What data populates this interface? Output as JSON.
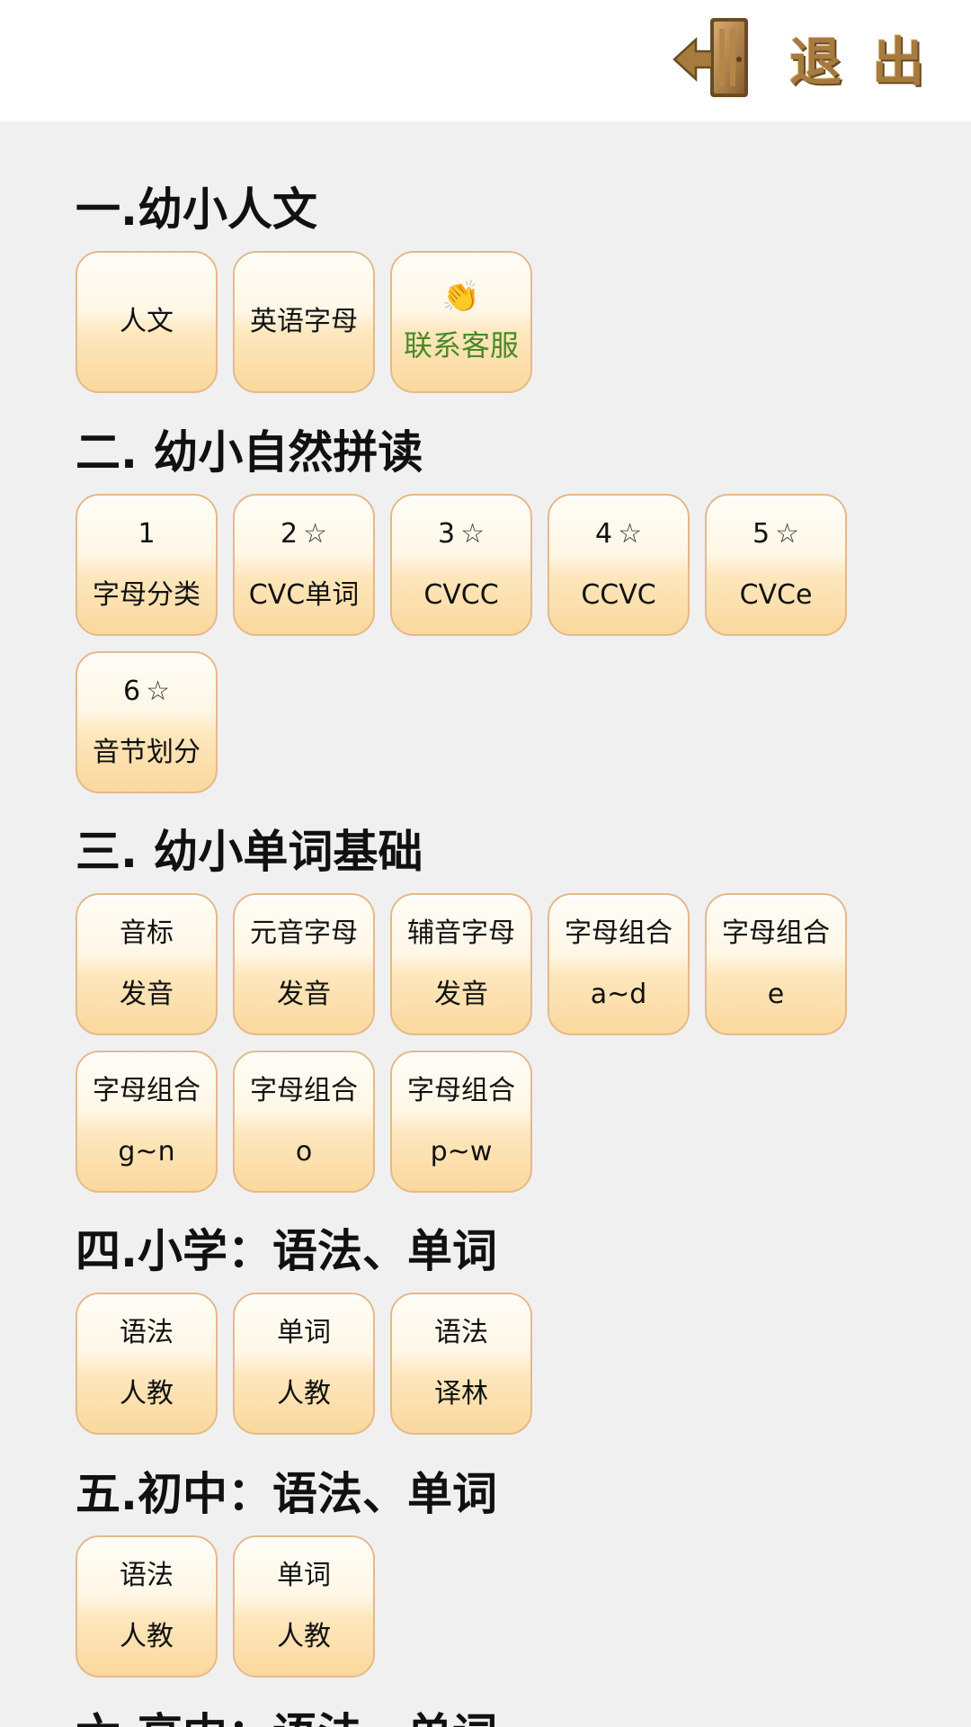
{
  "header": {
    "exit_label": "退出",
    "exit_icon": "exit-door-arrow-icon"
  },
  "sections": [
    {
      "title": "一.幼小人文",
      "tiles": [
        {
          "line1": "人文"
        },
        {
          "line1": "英语字母"
        },
        {
          "icon": "👏",
          "line1": "联系客服"
        }
      ]
    },
    {
      "title": "二. 幼小自然拼读",
      "tiles": [
        {
          "line1": "1",
          "line2": "字母分类"
        },
        {
          "line1": "2",
          "star": "☆",
          "line2": "CVC单词"
        },
        {
          "line1": "3",
          "star": "☆",
          "line2": "CVCC"
        },
        {
          "line1": "4",
          "star": "☆",
          "line2": "CCVC"
        },
        {
          "line1": "5",
          "star": "☆",
          "line2": "CVCe"
        },
        {
          "line1": "6",
          "star": "☆",
          "line2": "音节划分"
        }
      ]
    },
    {
      "title": "三. 幼小单词基础",
      "tiles": [
        {
          "line1": "音标",
          "line2": "发音"
        },
        {
          "line1": "元音字母",
          "line2": "发音"
        },
        {
          "line1": "辅音字母",
          "line2": "发音"
        },
        {
          "line1": "字母组合",
          "line2": "a~d"
        },
        {
          "line1": "字母组合",
          "line2": "e"
        },
        {
          "line1": "字母组合",
          "line2": "g~n"
        },
        {
          "line1": "字母组合",
          "line2": "o"
        },
        {
          "line1": "字母组合",
          "line2": "p~w"
        }
      ]
    },
    {
      "title": "四.小学：语法、单词",
      "tiles": [
        {
          "line1": "语法",
          "line2": "人教"
        },
        {
          "line1": "单词",
          "line2": "人教"
        },
        {
          "line1": "语法",
          "line2": "译林"
        }
      ]
    },
    {
      "title": "五.初中：语法、单词",
      "tiles": [
        {
          "line1": "语法",
          "line2": "人教"
        },
        {
          "line1": "单词",
          "line2": "人教"
        }
      ]
    },
    {
      "title": "六.高中：语法、单词",
      "tiles": []
    }
  ],
  "colors": {
    "page_bg": "#f0f0f0",
    "header_bg": "#ffffff",
    "tile_border": "#e4b98a",
    "tile_gradient_bottom": "#fbd89d",
    "contact_green": "#4a8a26",
    "exit_brown": "#a77a3e"
  }
}
